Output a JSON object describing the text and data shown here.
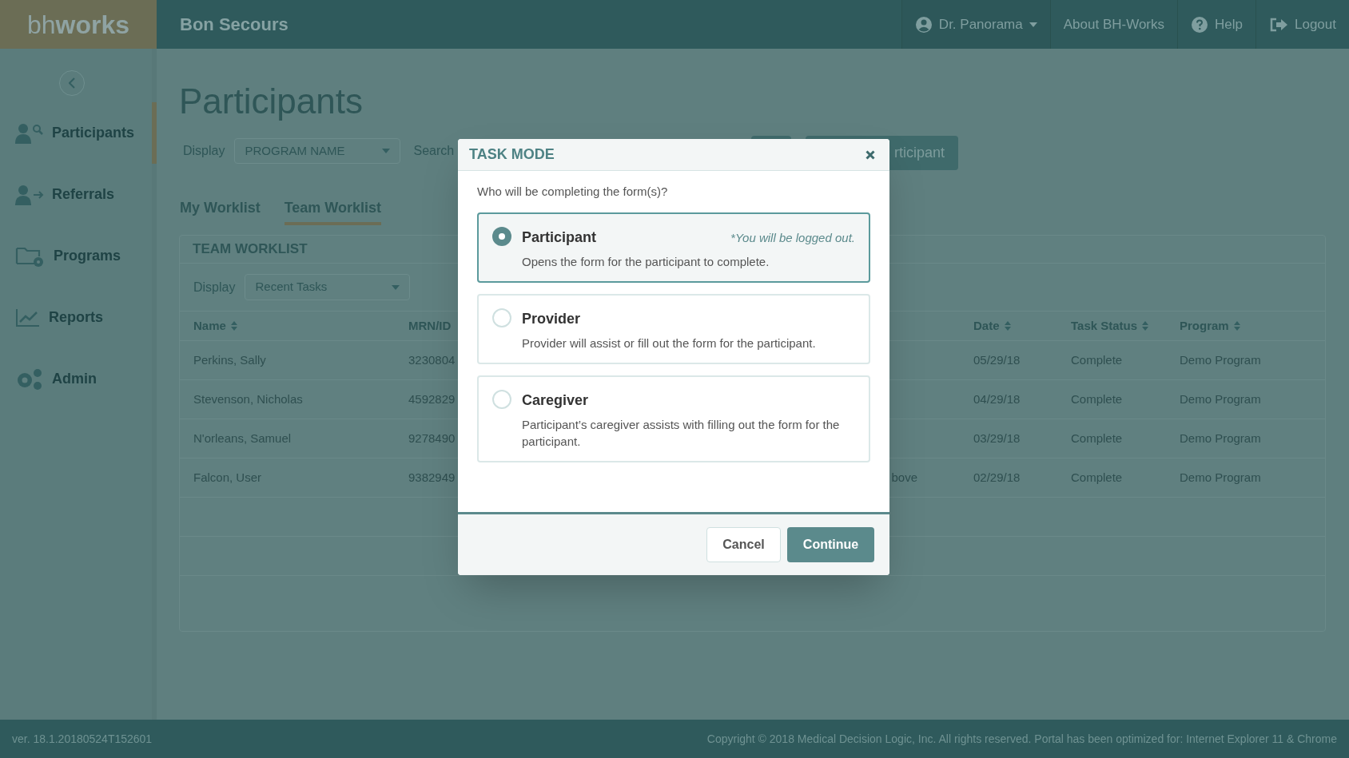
{
  "header": {
    "logo_light": "bh",
    "logo_bold": "works",
    "organization": "Bon Secours",
    "user": "Dr. Panorama",
    "links": [
      {
        "kind": "about",
        "label": "About BH-Works"
      },
      {
        "kind": "help",
        "label": "Help"
      },
      {
        "kind": "logout",
        "label": "Logout"
      }
    ]
  },
  "sidebar": {
    "items": [
      {
        "kind": "participants",
        "label": "Participants",
        "selected": true
      },
      {
        "kind": "referrals",
        "label": "Referrals",
        "selected": false
      },
      {
        "kind": "programs",
        "label": "Programs",
        "selected": false
      },
      {
        "kind": "reports",
        "label": "Reports",
        "selected": false
      },
      {
        "kind": "admin",
        "label": "Admin",
        "selected": false
      }
    ]
  },
  "page": {
    "title": "Participants",
    "display_label": "Display",
    "display_value": "PROGRAM NAME",
    "search_label": "Search",
    "add_button": "rticipant"
  },
  "tabs": [
    {
      "label": "My Worklist",
      "selected": false
    },
    {
      "label": "Team Worklist",
      "selected": true
    }
  ],
  "worklist": {
    "title": "TEAM WORKLIST",
    "display_label": "Display",
    "display_value": "Recent Tasks",
    "columns": [
      {
        "label": "Name",
        "sortable": true
      },
      {
        "label": "MRN/ID",
        "sortable": false
      },
      {
        "label": "Date",
        "sortable": true
      },
      {
        "label": "Task Status",
        "sortable": true
      },
      {
        "label": "Program",
        "sortable": true
      }
    ],
    "rows": [
      {
        "name": "Perkins, Sally",
        "mrn": "3230804",
        "column_3": "",
        "date": "05/29/18",
        "status": "Complete",
        "program": "Demo Program"
      },
      {
        "name": "Stevenson, Nicholas",
        "mrn": "4592829",
        "column_3": "",
        "date": "04/29/18",
        "status": "Complete",
        "program": "Demo Program"
      },
      {
        "name": "N'orleans, Samuel",
        "mrn": "9278490",
        "column_3": "",
        "date": "03/29/18",
        "status": "Complete",
        "program": "Demo Program"
      },
      {
        "name": "Falcon, User",
        "mrn": "9382949",
        "column_3": "bove",
        "date": "02/29/18",
        "status": "Complete",
        "program": "Demo Program"
      }
    ]
  },
  "modal": {
    "title": "TASK MODE",
    "question": "Who will be completing the form(s)?",
    "options": [
      {
        "label": "Participant",
        "note": "*You will be logged out.",
        "description": "Opens the form for the participant to complete.",
        "selected": true
      },
      {
        "label": "Provider",
        "description": "Provider will assist or fill out the form for the participant.",
        "selected": false
      },
      {
        "label": "Caregiver",
        "description": "Participant’s caregiver assists with filling out the form for the participant.",
        "selected": false
      }
    ],
    "buttons": [
      {
        "kind": "secondary",
        "label": "Cancel"
      },
      {
        "kind": "primary",
        "label": "Continue"
      }
    ]
  },
  "footer": {
    "version": "ver. 18.1.20180524T152601",
    "copyright": "Copyright © 2018 Medical Decision Logic, Inc. All rights reserved. Portal has been optimized for: Internet Explorer 11 & Chrome"
  }
}
